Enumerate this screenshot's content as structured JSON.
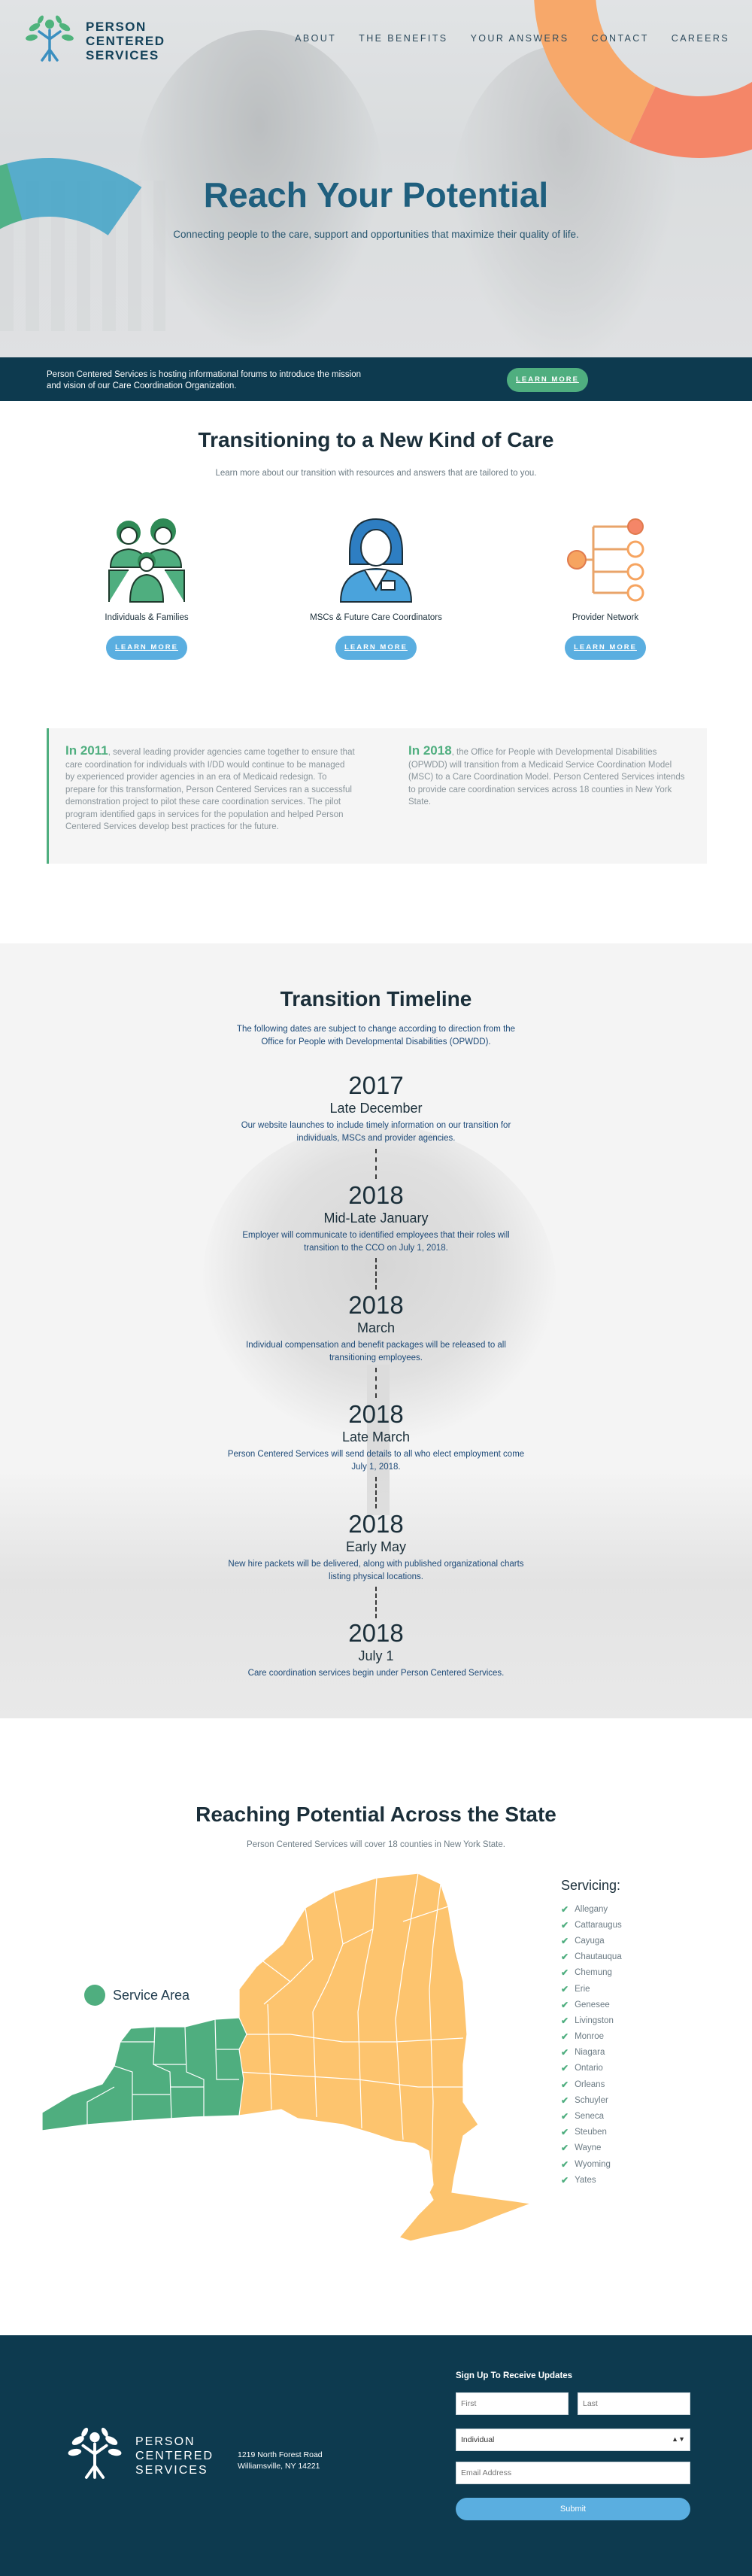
{
  "brand": {
    "name_line1": "PERSON",
    "name_line2": "CENTERED",
    "name_line3": "SERVICES"
  },
  "nav": {
    "items": [
      "ABOUT",
      "THE BENEFITS",
      "YOUR ANSWERS",
      "CONTACT",
      "CAREERS"
    ]
  },
  "hero": {
    "title": "Reach Your Potential",
    "subtitle": "Connecting people to the care, support and opportunities that maximize their quality of life."
  },
  "banner": {
    "text": "Person Centered Services is hosting informational forums to introduce the mission and vision of our Care Coordination Organization.",
    "button": "LEARN MORE"
  },
  "care": {
    "title": "Transitioning to a New Kind of Care",
    "lead": "Learn more about our transition with resources and answers that are tailored to you.",
    "cards": [
      {
        "label": "Individuals & Families",
        "button": "LEARN MORE",
        "icon": "family-icon"
      },
      {
        "label": "MSCs & Future Care Coordinators",
        "button": "LEARN MORE",
        "icon": "coordinator-icon"
      },
      {
        "label": "Provider Network",
        "button": "LEARN MORE",
        "icon": "network-icon"
      }
    ]
  },
  "history": {
    "left_year": "In 2011",
    "left_text": ", several leading provider agencies came together to ensure that care coordination for individuals with I/DD would continue to be managed by experienced provider agencies in an era of Medicaid redesign. To prepare for this transformation, Person Centered Services ran a successful demonstration project to pilot these care coordination services. The pilot program identified gaps in services for the population and helped Person Centered Services develop best practices for the future.",
    "right_year": "In 2018",
    "right_text": ", the Office for People with Developmental Disabilities (OPWDD) will transition from a Medicaid Service Coordination Model (MSC) to a Care Coordination Model. Person Centered Services intends to provide care coordination services across 18 counties in New York State."
  },
  "timeline": {
    "title": "Transition Timeline",
    "intro": "The following dates are subject to change according to direction from the Office for People with Developmental Disabilities (OPWDD).",
    "items": [
      {
        "year": "2017",
        "when": "Late December",
        "desc": "Our website launches to include timely information on our transition for individuals, MSCs and provider agencies."
      },
      {
        "year": "2018",
        "when": "Mid-Late January",
        "desc": "Employer will communicate to identified employees that their roles will transition to the CCO on July 1, 2018."
      },
      {
        "year": "2018",
        "when": "March",
        "desc": "Individual compensation and benefit packages will be released to all transitioning employees."
      },
      {
        "year": "2018",
        "when": "Late March",
        "desc": "Person Centered Services will send details to all who elect employment come July 1, 2018."
      },
      {
        "year": "2018",
        "when": "Early May",
        "desc": "New hire packets will be delivered, along with published organizational charts listing physical locations."
      },
      {
        "year": "2018",
        "when": "July 1",
        "desc": "Care coordination services begin under Person Centered Services."
      }
    ]
  },
  "map": {
    "title": "Reaching Potential Across the State",
    "lead": "Person Centered Services will cover 18 counties in New York State.",
    "legend": "Service Area",
    "service_color": "#4fae7f",
    "other_color": "#fdc46e",
    "servicing_title": "Servicing:",
    "counties": [
      "Allegany",
      "Cattaraugus",
      "Cayuga",
      "Chautauqua",
      "Chemung",
      "Erie",
      "Genesee",
      "Livingston",
      "Monroe",
      "Niagara",
      "Ontario",
      "Orleans",
      "Schuyler",
      "Seneca",
      "Steuben",
      "Wayne",
      "Wyoming",
      "Yates"
    ]
  },
  "footer": {
    "address_line1": "1219 North Forest Road",
    "address_line2": "Williamsville, NY 14221",
    "form_title": "Sign Up To Receive Updates",
    "first_placeholder": "First",
    "last_placeholder": "Last",
    "type_value": "Individual",
    "email_placeholder": "Email Address",
    "submit": "Submit"
  },
  "colors": {
    "navy": "#0d3a4f",
    "green": "#4fae7f",
    "blue": "#5aaee0",
    "orange": "#f48668"
  }
}
